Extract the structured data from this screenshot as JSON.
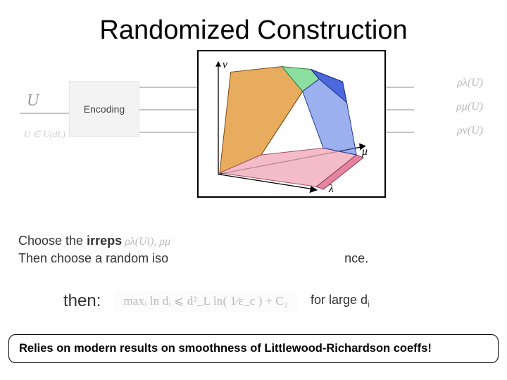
{
  "title": "Randomized Construction",
  "diagram": {
    "U_label": "U",
    "U_membership": "U ∈ U(dL)",
    "encoding_label": "Encoding",
    "outputs": {
      "rho_lambda": "ρλ(U)",
      "rho_mu": "ρμ(U)",
      "rho_nu": "ρν(U)"
    },
    "polytope_axes": {
      "nu": "ν",
      "mu": "μ",
      "lambda": "λ"
    }
  },
  "body_line1_a": "Choose the ",
  "body_line1_b": "irreps",
  "body_line1_math": "  ρλ(Ui), ρμ",
  "body_line2_a": "Then choose a random iso",
  "body_line2_b": "nce.",
  "then_label": "then:",
  "then_math": "maxᵢ ln dᵢ ⩽ d²_L ln( 1⁄ε_c ) + C₂",
  "then_right_a": "for large d",
  "then_right_sub": "i",
  "footer": "Relies on modern results on smoothness of Littlewood-Richardson coeffs!"
}
